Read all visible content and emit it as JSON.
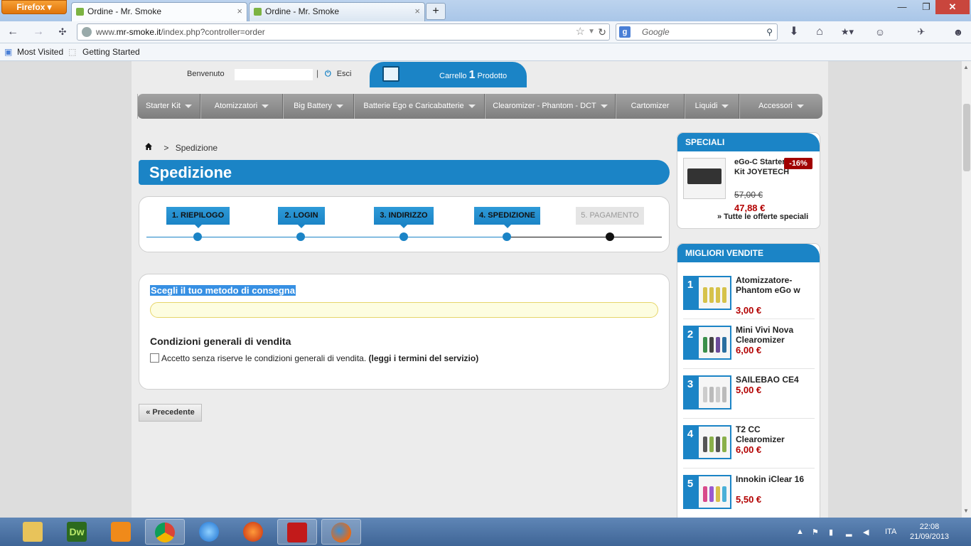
{
  "browser": {
    "app_button": "Firefox",
    "tabs": [
      {
        "label": "Ordine - Mr. Smoke",
        "close": "×"
      },
      {
        "label": "Ordine - Mr. Smoke",
        "close": "×"
      }
    ],
    "new_tab": "+",
    "url_prefix": "www.",
    "url_domain": "mr-smoke.it",
    "url_path": "/index.php?controller=order",
    "search_placeholder": "Google",
    "search_engine_letter": "g",
    "bookmarks": [
      "Most Visited",
      "Getting Started"
    ],
    "window_controls": {
      "minimize": "—",
      "maximize": "❐",
      "close": "✕"
    }
  },
  "header": {
    "welcome": "Benvenuto",
    "logout": "Esci",
    "logout_icon": "⏻",
    "cart_label": "Carrello",
    "cart_count": "1",
    "cart_unit": "Prodotto"
  },
  "menu": [
    {
      "label": "Starter Kit",
      "dropdown": true
    },
    {
      "label": "Atomizzatori",
      "dropdown": true
    },
    {
      "label": "Big Battery",
      "dropdown": true
    },
    {
      "label": "Batterie Ego e Caricabatterie",
      "dropdown": true
    },
    {
      "label": "Clearomizer - Phantom - DCT",
      "dropdown": true
    },
    {
      "label": "Cartomizer",
      "dropdown": false
    },
    {
      "label": "Liquidi",
      "dropdown": true
    },
    {
      "label": "Accessori",
      "dropdown": true
    }
  ],
  "breadcrumb": {
    "separator": ">",
    "current": "Spedizione"
  },
  "page_title": "Spedizione",
  "steps": [
    {
      "label": "1. RIEPILOGO",
      "state": "done"
    },
    {
      "label": "2. LOGIN",
      "state": "done"
    },
    {
      "label": "3. INDIRIZZO",
      "state": "done"
    },
    {
      "label": "4. SPEDIZIONE",
      "state": "current"
    },
    {
      "label": "5. PAGAMENTO",
      "state": "disabled"
    }
  ],
  "shipping": {
    "title": "Scegli il tuo metodo di consegna",
    "conditions_title": "Condizioni generali di vendita",
    "accept_text": "Accetto senza riserve le condizioni generali di vendita.",
    "terms_link": "(leggi i termini del servizio)",
    "accepted": false
  },
  "prev_button": "« Precedente",
  "specials": {
    "title": "SPECIALI",
    "product": "eGo-C Starter Kit JOYETECH",
    "discount": "-16%",
    "old_price": "57,00 €",
    "new_price": "47,88 €",
    "all_link": "» Tutte le offerte speciali"
  },
  "bestsellers": {
    "title": "MIGLIORI VENDITE",
    "items": [
      {
        "rank": "1",
        "name": "Atomizzatore-Phantom eGo w",
        "price": "3,00 €"
      },
      {
        "rank": "2",
        "name": "Mini Vivi Nova Clearomizer",
        "price": "6,00 €"
      },
      {
        "rank": "3",
        "name": "SAILEBAO CE4",
        "price": "5,00 €"
      },
      {
        "rank": "4",
        "name": "T2 CC Clearomizer",
        "price": "6,00 €"
      },
      {
        "rank": "5",
        "name": "Innokin iClear 16",
        "price": "5,50 €"
      }
    ]
  },
  "taskbar": {
    "apps": [
      "folder-icon",
      "dreamweaver-icon",
      "media-player-icon",
      "chrome-icon",
      "app-icon",
      "firefox-dev-icon",
      "acrobat-icon",
      "firefox-icon"
    ],
    "dreamweaver_label": "Dw",
    "language": "ITA",
    "time": "22:08",
    "date": "21/09/2013"
  },
  "colors": {
    "brand_blue": "#1b84c6",
    "price_red": "#b30000",
    "menu_gray": "#8f8f8f"
  }
}
